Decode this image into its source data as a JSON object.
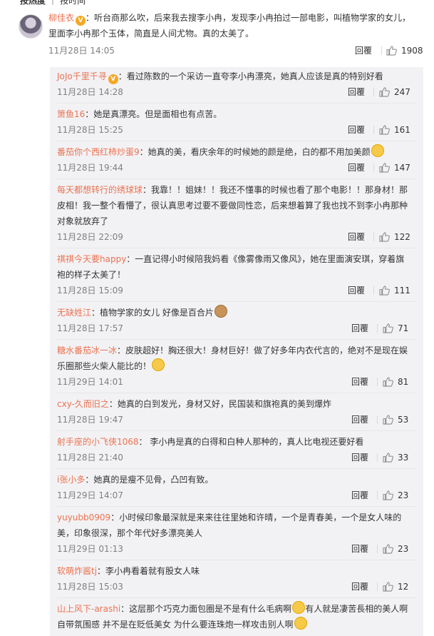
{
  "tabs": {
    "hot": "按热度",
    "time": "按时间"
  },
  "main": {
    "user": "柳佳衣",
    "line1": "：听台商那么吹，后来我去搜李小冉，发现李小冉拍过一部电影，叫植物学家的女儿，",
    "line2": "里面李小冉那个玉体，简直是人间尤物。真的太美了。",
    "time": "11月28日 14:05",
    "reply": "回覆",
    "likes": "1908"
  },
  "replies": [
    {
      "user": "JoJo千里千寻",
      "lines": [
        "：看过陈数的一个采访一直夸李小冉漂亮，她真人应该是真的特别好看"
      ],
      "time": "11月28日 14:28",
      "reply": "回覆",
      "likes": "247"
    },
    {
      "user": "箫鱼16",
      "lines": [
        "：她是真漂亮。但是面相也有点苦。"
      ],
      "time": "11月28日 15:25",
      "reply": "回覆",
      "likes": "161"
    },
    {
      "user": "番茄你个西红柿炒蛋9",
      "lines": [
        "：她真的美，看庆余年的时候她的颜是绝，白的都不用加美颜"
      ],
      "time": "11月28日 19:44",
      "reply": "回覆",
      "likes": "147"
    },
    {
      "user": "每天都想转行的绣球球",
      "lines": [
        "：我靠！！姐妹！！我还不懂事的时候也看了那个电影！！那身材！那",
        "皮相！我一整个看懵了，很认真思考过要不要做同性恋，后来想着算了我也找不到李小冉那种",
        "对象就放弃了"
      ],
      "time": "11月28日 22:09",
      "reply": "回覆",
      "likes": "122"
    },
    {
      "user": "祺祺今天要happy",
      "lines": [
        "：一直记得小时候陪我妈看《像雾像雨又像风》，她在里面演安琪，穿着旗",
        "袍的样子太美了！"
      ],
      "time": "11月28日 15:09",
      "reply": "回覆",
      "likes": "111"
    },
    {
      "user": "无缺姓江",
      "lines": [
        "：植物学家的女儿 好像是百合片"
      ],
      "time": "11月28日 17:57",
      "reply": "回覆",
      "likes": "71"
    },
    {
      "user": "糖水番茄冰一冰",
      "lines": [
        "：皮肤超好！胸还很大！身材巨好！做了好多年内衣代言的，绝对不是现在娱",
        "乐圈那些火柴人能比的！"
      ],
      "time": "11月29日 14:01",
      "reply": "回覆",
      "likes": "81"
    },
    {
      "user": "cxy-久而旧之",
      "lines": [
        "：她真的白到发光，身材又好，民国装和旗袍真的美到爆炸"
      ],
      "time": "11月28日 19:47",
      "reply": "回覆",
      "likes": "53"
    },
    {
      "user": "射手座的小飞侠1068",
      "lines": [
        "： 李小冉是真的白得和白种人那种的，真人比电视还要好看"
      ],
      "time": "11月28日 21:40",
      "reply": "回覆",
      "likes": "33"
    },
    {
      "user": "i张小多",
      "lines": [
        "：她真的是瘦不见骨，凸凹有致。"
      ],
      "time": "11月29日 14:07",
      "reply": "回覆",
      "likes": "23"
    },
    {
      "user": "yuyubb0909",
      "lines": [
        "：小时候印象最深就是来来往往里她和许晴，一个是青春美，一个是女人味的",
        "美，印象很深，那个年代好多漂亮美人"
      ],
      "time": "11月29日 01:13",
      "reply": "回覆",
      "likes": "23"
    },
    {
      "user": "软萌炸酱tj",
      "lines": [
        "：李小冉看着就有股女人味"
      ],
      "time": "11月28日 15:03",
      "reply": "回覆",
      "likes": "12"
    },
    {
      "user": "山上风下-arashi",
      "lines": [
        "：这层那个巧克力面包圈是不是有什么毛病啊",
        "有人就是凄苦長相的美人啊",
        "自带氛围感 并不是在贬低美女 为什么要连珠炮一样攻击别人啊"
      ],
      "time": "",
      "reply": "",
      "likes": ""
    }
  ]
}
